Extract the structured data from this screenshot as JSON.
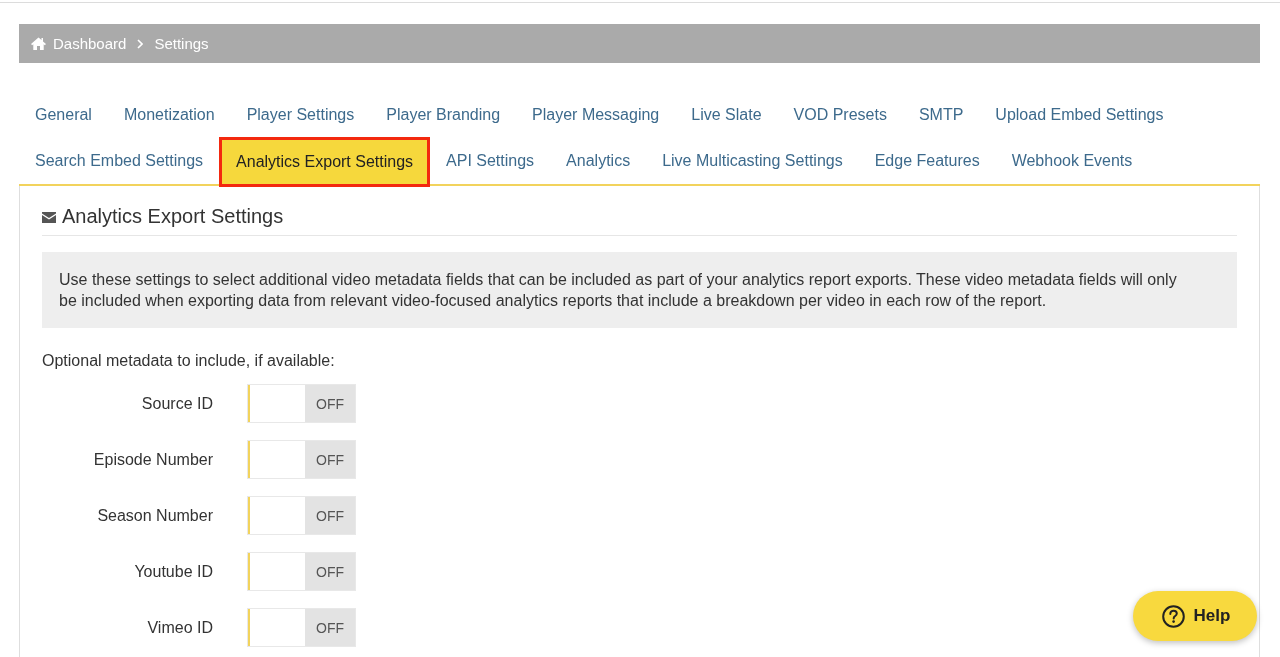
{
  "breadcrumb": [
    {
      "label": "Dashboard"
    },
    {
      "label": "Settings"
    }
  ],
  "tab_rows": [
    [
      {
        "label": "General",
        "selected": false
      },
      {
        "label": "Monetization",
        "selected": false
      },
      {
        "label": "Player Settings",
        "selected": false
      },
      {
        "label": "Player Branding",
        "selected": false
      },
      {
        "label": "Player Messaging",
        "selected": false
      },
      {
        "label": "Live Slate",
        "selected": false
      },
      {
        "label": "VOD Presets",
        "selected": false
      },
      {
        "label": "SMTP",
        "selected": false
      },
      {
        "label": "Upload Embed Settings",
        "selected": false
      }
    ],
    [
      {
        "label": "Search Embed Settings",
        "selected": false
      },
      {
        "label": "Analytics Export Settings",
        "selected": true
      },
      {
        "label": "API Settings",
        "selected": false
      },
      {
        "label": "Analytics",
        "selected": false
      },
      {
        "label": "Live Multicasting Settings",
        "selected": false
      },
      {
        "label": "Edge Features",
        "selected": false
      },
      {
        "label": "Webhook Events",
        "selected": false
      }
    ]
  ],
  "section": {
    "title": "Analytics Export Settings",
    "description": "Use these settings to select additional video metadata fields that can be included as part of your analytics report exports. These video metadata fields will only be included when exporting data from relevant video-focused analytics reports that include a breakdown per video in each row of the report.",
    "options_label": "Optional metadata to include, if available:",
    "options": [
      {
        "label": "Source ID",
        "on": false,
        "state_label": "OFF"
      },
      {
        "label": "Episode Number",
        "on": false,
        "state_label": "OFF"
      },
      {
        "label": "Season Number",
        "on": false,
        "state_label": "OFF"
      },
      {
        "label": "Youtube ID",
        "on": false,
        "state_label": "OFF"
      },
      {
        "label": "Vimeo ID",
        "on": false,
        "state_label": "OFF"
      }
    ]
  },
  "help_button": {
    "label": "Help"
  }
}
